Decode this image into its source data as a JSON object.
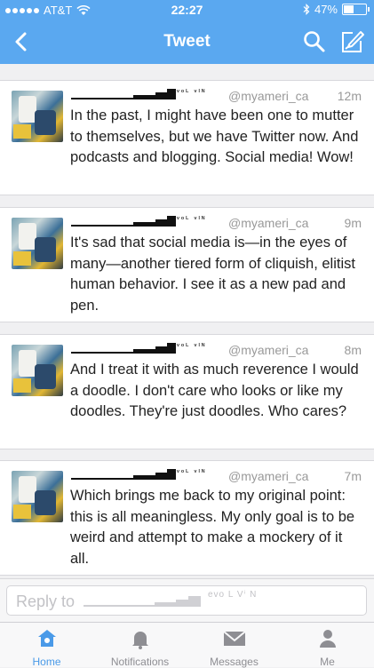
{
  "status_bar": {
    "carrier": "AT&T",
    "time": "22:27",
    "battery_percent": "47%",
    "battery_level": 0.47
  },
  "nav": {
    "title": "Tweet"
  },
  "tweets": [
    {
      "brand": "ᵛᵒᴸ ᵛᴵᴺ",
      "handle": "@myameri_ca",
      "time": "12m",
      "text": "In the past, I might have been one to mutter to themselves, but we have Twitter now. And podcasts and blogging. Social media! Wow!"
    },
    {
      "brand": "ᵛᵒᴸ ᵛᴵᴺ",
      "handle": "@myameri_ca",
      "time": "9m",
      "text": "It's sad that social media is—in the eyes of many—another tiered form of cliquish, elitist human behavior. I see it as a new pad and pen."
    },
    {
      "brand": "ᵛᵒᴸ ᵛᴵᴺ",
      "handle": "@myameri_ca",
      "time": "8m",
      "text": "And I treat it with as much reverence I would a doodle. I don't care who looks or like my doodles. They're just doodles. Who cares?"
    },
    {
      "brand": "ᵛᵒᴸ ᵛᴵᴺ",
      "handle": "@myameri_ca",
      "time": "7m",
      "text": "Which brings me back to my original point: this is all meaningless. My only goal is to be weird and attempt to make a mockery of it all."
    }
  ],
  "reply": {
    "placeholder": "Reply to",
    "brand": "evo L Vⁱ N"
  },
  "tabs": [
    {
      "label": "Home",
      "icon": "home-icon",
      "active": true
    },
    {
      "label": "Notifications",
      "icon": "bell-icon",
      "active": false
    },
    {
      "label": "Messages",
      "icon": "envelope-icon",
      "active": false
    },
    {
      "label": "Me",
      "icon": "person-icon",
      "active": false
    }
  ],
  "colors": {
    "accent": "#5aa8f0",
    "tab_active": "#4a9ae8",
    "tab_inactive": "#8e8e93"
  }
}
